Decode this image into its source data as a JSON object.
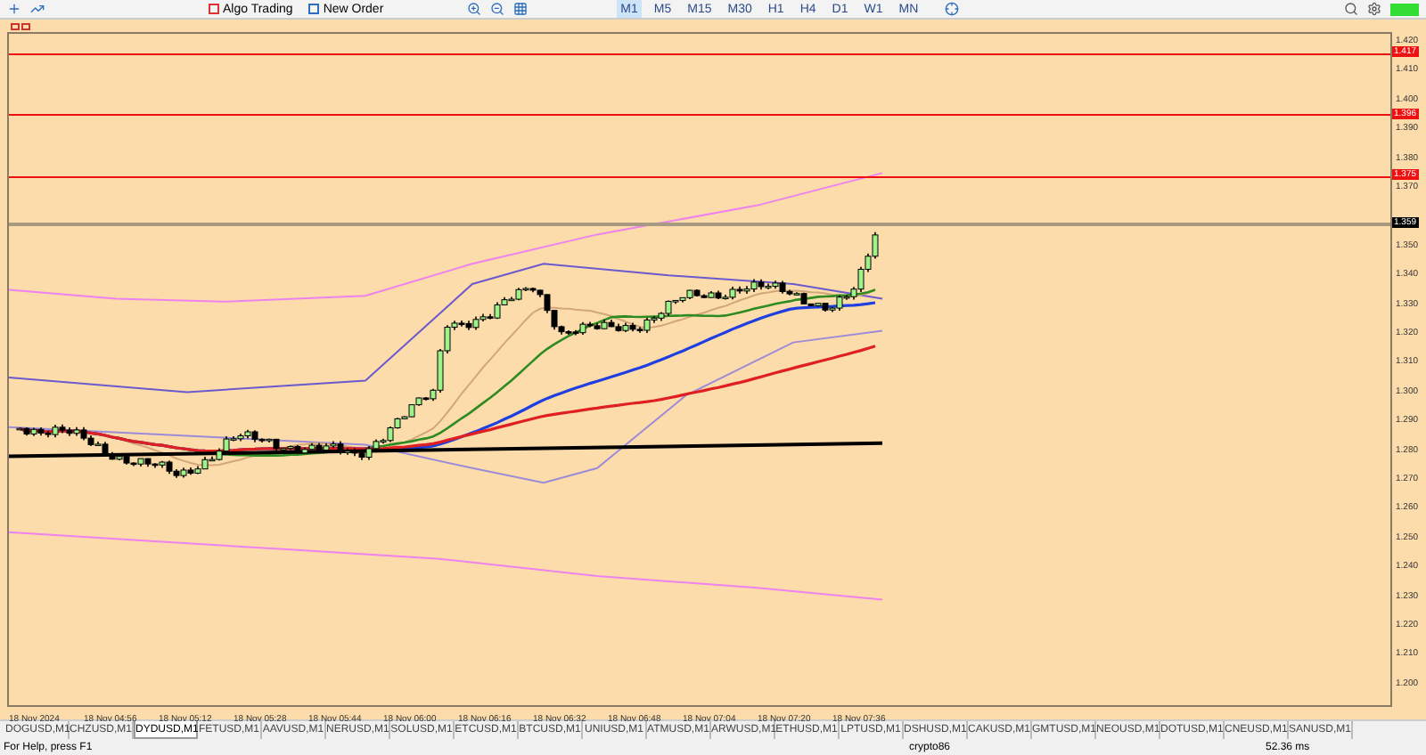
{
  "toolbar": {
    "buttons": [
      {
        "label": "Algo Trading",
        "kind": "algo"
      },
      {
        "label": "New Order",
        "kind": "order"
      }
    ],
    "timeframes": [
      {
        "label": "M1",
        "selected": true
      },
      {
        "label": "M5",
        "selected": false
      },
      {
        "label": "M15",
        "selected": false
      },
      {
        "label": "M30",
        "selected": false
      },
      {
        "label": "H1",
        "selected": false
      },
      {
        "label": "H4",
        "selected": false
      },
      {
        "label": "D1",
        "selected": false
      },
      {
        "label": "W1",
        "selected": false
      },
      {
        "label": "MN",
        "selected": false
      }
    ]
  },
  "chart": {
    "price_levels": [
      {
        "label": "1.417",
        "kind": "alert"
      },
      {
        "label": "1.396",
        "kind": "alert"
      },
      {
        "label": "1.375",
        "kind": "alert"
      },
      {
        "label": "1.359",
        "kind": "current"
      }
    ],
    "price_axis": [
      "1.420",
      "1.410",
      "1.400",
      "1.390",
      "1.380",
      "1.370",
      "1.350",
      "1.340",
      "1.330",
      "1.320",
      "1.310",
      "1.300",
      "1.290",
      "1.280",
      "1.270",
      "1.260",
      "1.250",
      "1.240",
      "1.230",
      "1.220",
      "1.210",
      "1.200"
    ],
    "time_axis": [
      "18 Nov 2024",
      "18 Nov 04:56",
      "18 Nov 05:12",
      "18 Nov 05:28",
      "18 Nov 05:44",
      "18 Nov 06:00",
      "18 Nov 06:16",
      "18 Nov 06:32",
      "18 Nov 06:48",
      "18 Nov 07:04",
      "18 Nov 07:20",
      "18 Nov 07:36"
    ]
  },
  "symbol_tabs": [
    {
      "label": "DOGUSD,M1",
      "selected": false
    },
    {
      "label": "CHZUSD,M1",
      "selected": false
    },
    {
      "label": "DYDUSD,M1",
      "selected": true
    },
    {
      "label": "FETUSD,M1",
      "selected": false
    },
    {
      "label": "AAVUSD,M1",
      "selected": false
    },
    {
      "label": "NERUSD,M1",
      "selected": false
    },
    {
      "label": "SOLUSD,M1",
      "selected": false
    },
    {
      "label": "ETCUSD,M1",
      "selected": false
    },
    {
      "label": "BTCUSD,M1",
      "selected": false
    },
    {
      "label": "UNIUSD,M1",
      "selected": false
    },
    {
      "label": "ATMUSD,M1",
      "selected": false
    },
    {
      "label": "ARWUSD,M1",
      "selected": false
    },
    {
      "label": "ETHUSD,M1",
      "selected": false
    },
    {
      "label": "LPTUSD,M1",
      "selected": false
    },
    {
      "label": "DSHUSD,M1",
      "selected": false
    },
    {
      "label": "CAKUSD,M1",
      "selected": false
    },
    {
      "label": "GMTUSD,M1",
      "selected": false
    },
    {
      "label": "NEOUSD,M1",
      "selected": false
    },
    {
      "label": "DOTUSD,M1",
      "selected": false
    },
    {
      "label": "CNEUSD,M1",
      "selected": false
    },
    {
      "label": "SANUSD,M1",
      "selected": false
    }
  ],
  "status_bar": {
    "help": "For Help, press F1",
    "profile": "crypto86",
    "ping": "52.36 ms"
  }
}
